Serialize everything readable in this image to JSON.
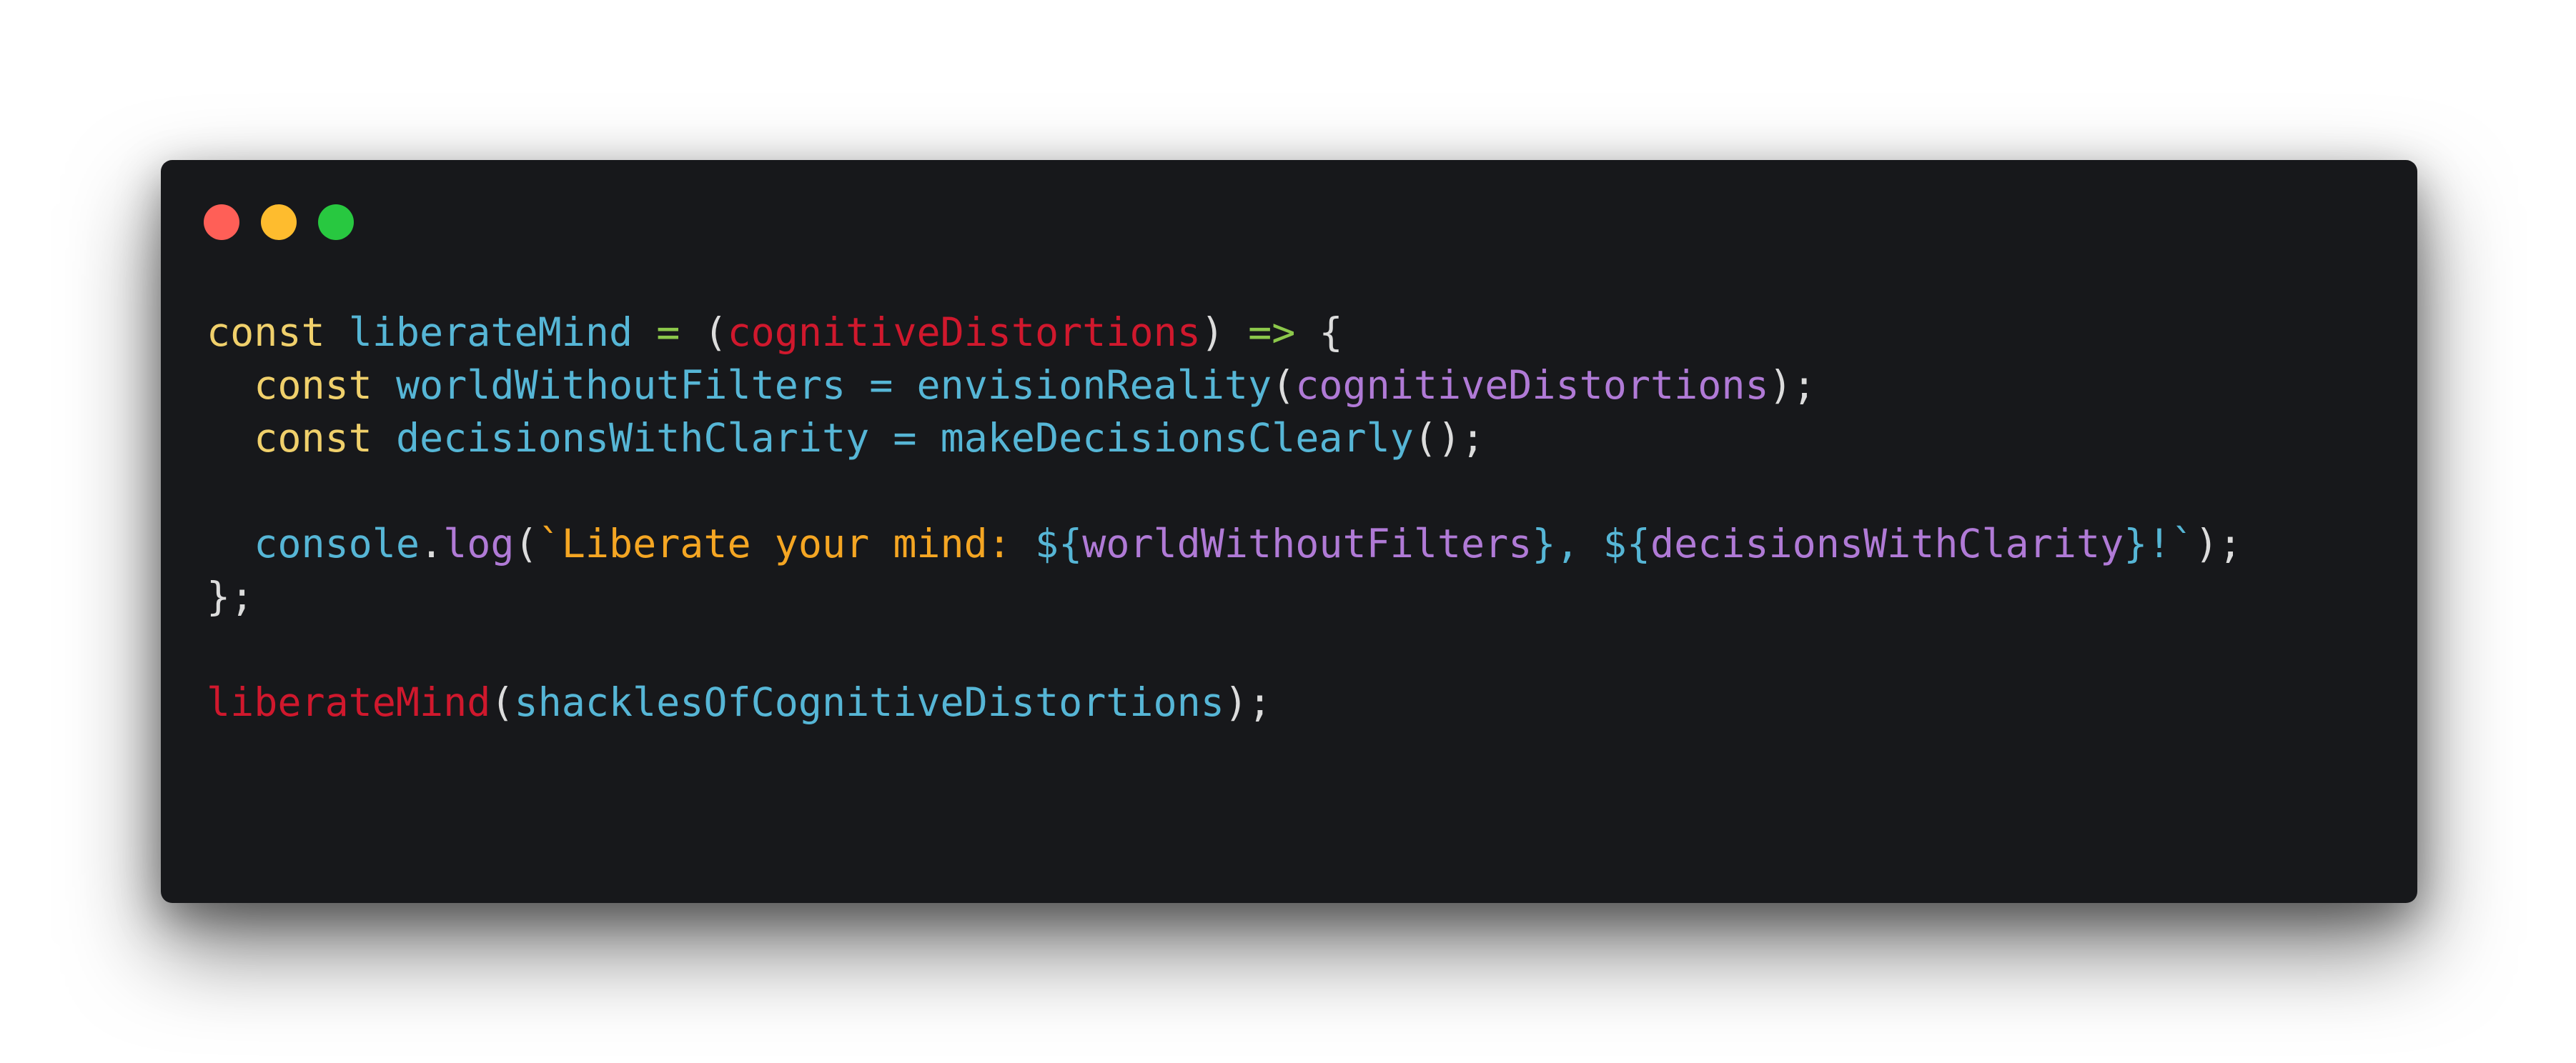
{
  "window": {
    "traffic_lights": [
      {
        "name": "close-dot",
        "color": "#ff5f57"
      },
      {
        "name": "minimize-dot",
        "color": "#febc2e"
      },
      {
        "name": "maximize-dot",
        "color": "#28c840"
      }
    ]
  },
  "colors": {
    "keyword": "#f0d06b",
    "variable": "#56b6d6",
    "operator": "#8cc84b",
    "param": "#d0182d",
    "punct": "#dcdcdc",
    "arg": "#b07ad6",
    "string": "#f5a623",
    "background": "#17181b"
  },
  "code": {
    "lines": [
      {
        "indent": "",
        "tokens": [
          {
            "t": "const",
            "c": "keyword"
          },
          {
            "t": " ",
            "c": "punct"
          },
          {
            "t": "liberateMind",
            "c": "variable"
          },
          {
            "t": " ",
            "c": "punct"
          },
          {
            "t": "=",
            "c": "operator"
          },
          {
            "t": " ",
            "c": "punct"
          },
          {
            "t": "(",
            "c": "punct"
          },
          {
            "t": "cognitiveDistortions",
            "c": "param"
          },
          {
            "t": ")",
            "c": "punct"
          },
          {
            "t": " ",
            "c": "punct"
          },
          {
            "t": "=>",
            "c": "operator"
          },
          {
            "t": " ",
            "c": "punct"
          },
          {
            "t": "{",
            "c": "punct"
          }
        ]
      },
      {
        "indent": "  ",
        "tokens": [
          {
            "t": "const",
            "c": "keyword"
          },
          {
            "t": " ",
            "c": "punct"
          },
          {
            "t": "worldWithoutFilters",
            "c": "variable"
          },
          {
            "t": " ",
            "c": "punct"
          },
          {
            "t": "=",
            "c": "variable"
          },
          {
            "t": " ",
            "c": "punct"
          },
          {
            "t": "envisionReality",
            "c": "variable"
          },
          {
            "t": "(",
            "c": "punct"
          },
          {
            "t": "cognitiveDistortions",
            "c": "arg"
          },
          {
            "t": ");",
            "c": "punct"
          }
        ]
      },
      {
        "indent": "  ",
        "tokens": [
          {
            "t": "const",
            "c": "keyword"
          },
          {
            "t": " ",
            "c": "punct"
          },
          {
            "t": "decisionsWithClarity",
            "c": "variable"
          },
          {
            "t": " ",
            "c": "punct"
          },
          {
            "t": "=",
            "c": "variable"
          },
          {
            "t": " ",
            "c": "punct"
          },
          {
            "t": "makeDecisionsClearly",
            "c": "variable"
          },
          {
            "t": "();",
            "c": "punct"
          }
        ]
      },
      {
        "indent": "",
        "tokens": []
      },
      {
        "indent": "  ",
        "tokens": [
          {
            "t": "console",
            "c": "variable"
          },
          {
            "t": ".",
            "c": "punct"
          },
          {
            "t": "log",
            "c": "arg"
          },
          {
            "t": "(",
            "c": "punct"
          },
          {
            "t": "`Liberate your mind: ",
            "c": "string"
          },
          {
            "t": "${",
            "c": "variable"
          },
          {
            "t": "worldWithoutFilters",
            "c": "arg"
          },
          {
            "t": "}, ",
            "c": "variable"
          },
          {
            "t": "${",
            "c": "variable"
          },
          {
            "t": "decisionsWithClarity",
            "c": "arg"
          },
          {
            "t": "}!`",
            "c": "variable"
          },
          {
            "t": ");",
            "c": "punct"
          }
        ]
      },
      {
        "indent": "",
        "tokens": [
          {
            "t": "};",
            "c": "punct"
          }
        ]
      },
      {
        "indent": "",
        "tokens": []
      },
      {
        "indent": "",
        "tokens": [
          {
            "t": "liberateMind",
            "c": "param"
          },
          {
            "t": "(",
            "c": "punct"
          },
          {
            "t": "shacklesOfCognitiveDistortions",
            "c": "variable"
          },
          {
            "t": ");",
            "c": "punct"
          }
        ]
      }
    ]
  }
}
